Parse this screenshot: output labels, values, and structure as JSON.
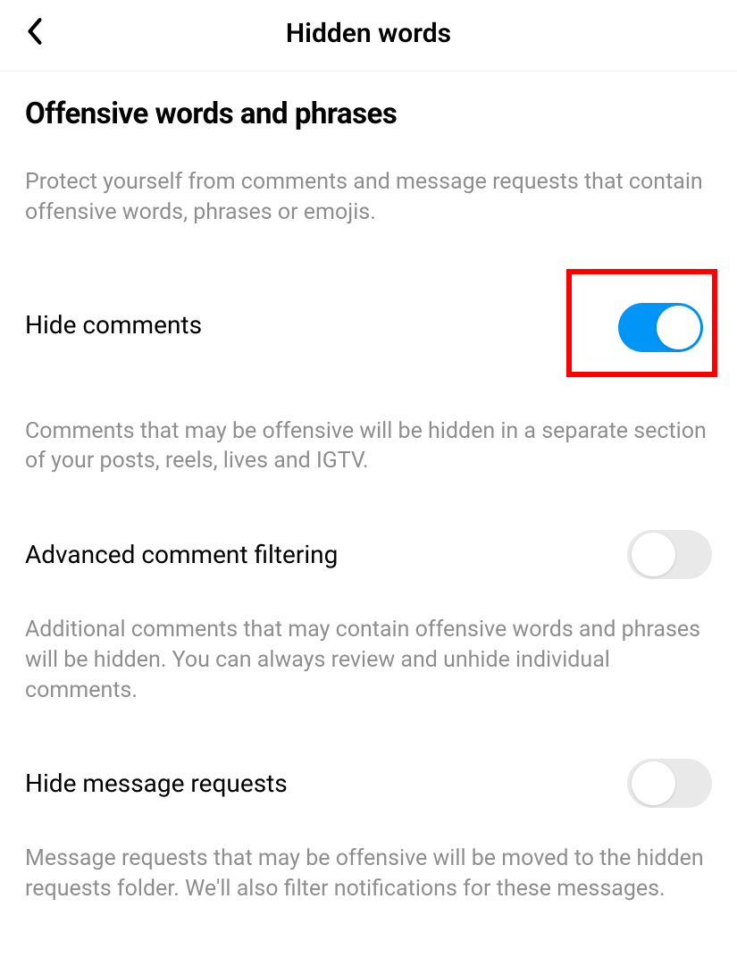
{
  "header": {
    "title": "Hidden words"
  },
  "section": {
    "title": "Offensive words and phrases",
    "description": "Protect yourself from comments and message requests that contain offensive words, phrases or emojis."
  },
  "settings": [
    {
      "label": "Hide comments",
      "enabled": true,
      "highlighted": true,
      "description": "Comments that may be offensive will be hidden in a separate section of your posts, reels, lives and IGTV."
    },
    {
      "label": "Advanced comment filtering",
      "enabled": false,
      "highlighted": false,
      "description": "Additional comments that may contain offensive words and phrases will be hidden. You can always review and unhide individual comments."
    },
    {
      "label": "Hide message requests",
      "enabled": false,
      "highlighted": false,
      "description": "Message requests that may be offensive will be moved to the hidden requests folder. We'll also filter notifications for these messages."
    }
  ]
}
